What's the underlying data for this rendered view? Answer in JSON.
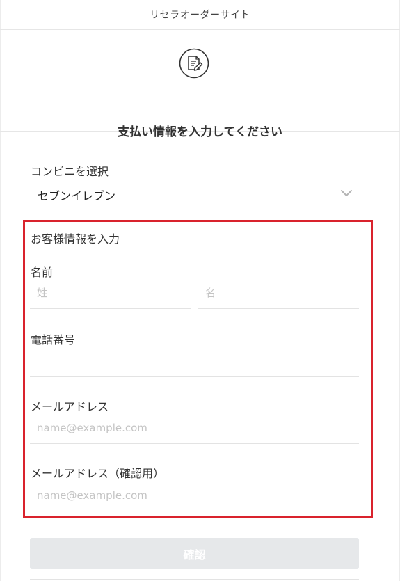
{
  "header": {
    "title": "リセラオーダーサイト"
  },
  "hero": {
    "icon": "document-edit-icon",
    "title": "支払い情報を入力してください"
  },
  "store": {
    "label": "コンビニを選択",
    "selected": "セブンイレブン"
  },
  "customer": {
    "section_label": "お客様情報を入力",
    "name_label": "名前",
    "last_name_placeholder": "姓",
    "first_name_placeholder": "名",
    "phone_label": "電話番号",
    "phone_value": "",
    "email_label": "メールアドレス",
    "email_placeholder": "name@example.com",
    "email_confirm_label": "メールアドレス（確認用）",
    "email_confirm_placeholder": "name@example.com"
  },
  "actions": {
    "confirm_label": "確認"
  },
  "colors": {
    "highlight": "#d9232d",
    "button_disabled": "#e6e8ea",
    "divider": "#e3e3e3"
  }
}
